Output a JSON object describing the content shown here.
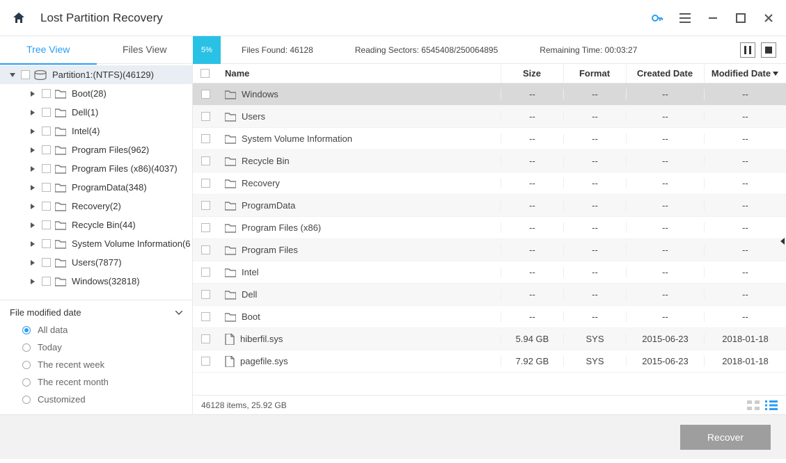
{
  "title": "Lost Partition Recovery",
  "tabs": {
    "tree": "Tree View",
    "files": "Files View"
  },
  "progress": {
    "percent": "5%"
  },
  "stats": {
    "files_found_label": "Files Found:",
    "files_found": "46128",
    "reading_label": "Reading Sectors:",
    "reading": "6545408/250064895",
    "remaining_label": "Remaining Time:",
    "remaining": "00:03:27"
  },
  "tree": {
    "root": "Partition1:(NTFS)(46129)",
    "children": [
      "Boot(28)",
      "Dell(1)",
      "Intel(4)",
      "Program Files(962)",
      "Program Files (x86)(4037)",
      "ProgramData(348)",
      "Recovery(2)",
      "Recycle Bin(44)",
      "System Volume Information(6",
      "Users(7877)",
      "Windows(32818)"
    ]
  },
  "filter": {
    "title": "File modified date",
    "options": [
      "All data",
      "Today",
      "The recent week",
      "The recent month",
      "Customized"
    ],
    "selected": 0
  },
  "columns": {
    "name": "Name",
    "size": "Size",
    "format": "Format",
    "created": "Created Date",
    "modified": "Modified Date"
  },
  "rows": [
    {
      "name": "Windows",
      "type": "folder",
      "size": "--",
      "format": "--",
      "created": "--",
      "modified": "--",
      "sel": true
    },
    {
      "name": "Users",
      "type": "folder",
      "size": "--",
      "format": "--",
      "created": "--",
      "modified": "--"
    },
    {
      "name": "System Volume Information",
      "type": "folder",
      "size": "--",
      "format": "--",
      "created": "--",
      "modified": "--"
    },
    {
      "name": "Recycle Bin",
      "type": "folder",
      "size": "--",
      "format": "--",
      "created": "--",
      "modified": "--"
    },
    {
      "name": "Recovery",
      "type": "folder",
      "size": "--",
      "format": "--",
      "created": "--",
      "modified": "--"
    },
    {
      "name": "ProgramData",
      "type": "folder",
      "size": "--",
      "format": "--",
      "created": "--",
      "modified": "--"
    },
    {
      "name": "Program Files (x86)",
      "type": "folder",
      "size": "--",
      "format": "--",
      "created": "--",
      "modified": "--"
    },
    {
      "name": "Program Files",
      "type": "folder",
      "size": "--",
      "format": "--",
      "created": "--",
      "modified": "--"
    },
    {
      "name": "Intel",
      "type": "folder",
      "size": "--",
      "format": "--",
      "created": "--",
      "modified": "--"
    },
    {
      "name": "Dell",
      "type": "folder",
      "size": "--",
      "format": "--",
      "created": "--",
      "modified": "--"
    },
    {
      "name": "Boot",
      "type": "folder",
      "size": "--",
      "format": "--",
      "created": "--",
      "modified": "--"
    },
    {
      "name": "hiberfil.sys",
      "type": "file",
      "size": "5.94 GB",
      "format": "SYS",
      "created": "2015-06-23",
      "modified": "2018-01-18"
    },
    {
      "name": "pagefile.sys",
      "type": "file",
      "size": "7.92 GB",
      "format": "SYS",
      "created": "2015-06-23",
      "modified": "2018-01-18"
    }
  ],
  "status": "46128 items, 25.92 GB",
  "footer": {
    "recover": "Recover"
  }
}
